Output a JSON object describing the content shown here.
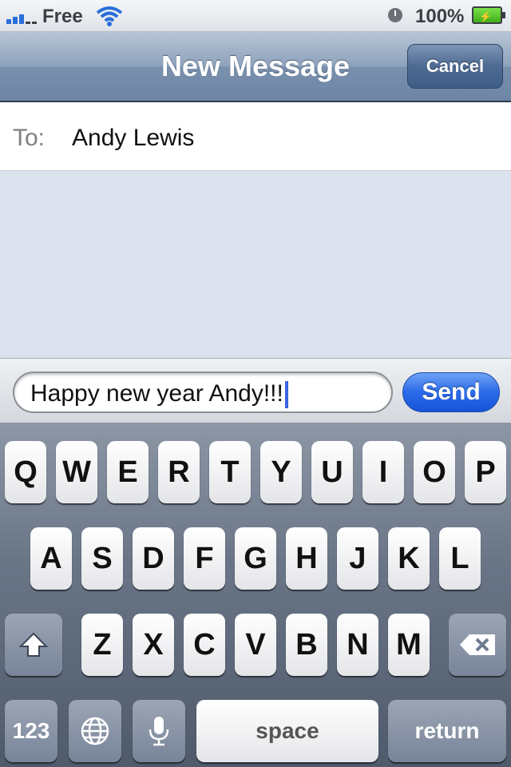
{
  "status_bar": {
    "carrier": "Free",
    "battery": "100%"
  },
  "nav": {
    "title": "New Message",
    "cancel_label": "Cancel"
  },
  "recipient": {
    "label": "To:",
    "value": "Andy Lewis"
  },
  "compose": {
    "text": "Happy new year Andy!!!",
    "send_label": "Send"
  },
  "keyboard": {
    "row1": [
      "Q",
      "W",
      "E",
      "R",
      "T",
      "Y",
      "U",
      "I",
      "O",
      "P"
    ],
    "row2": [
      "A",
      "S",
      "D",
      "F",
      "G",
      "H",
      "J",
      "K",
      "L"
    ],
    "row3": [
      "Z",
      "X",
      "C",
      "V",
      "B",
      "N",
      "M"
    ],
    "numbers_label": "123",
    "space_label": "space",
    "return_label": "return"
  },
  "icons": {
    "signal": "signal-bars-icon",
    "wifi": "wifi-icon",
    "alarm": "alarm-clock-icon",
    "battery": "battery-charging-icon",
    "shift": "shift-icon",
    "backspace": "backspace-icon",
    "globe": "globe-icon",
    "microphone": "microphone-icon"
  },
  "colors": {
    "send_blue": "#2b6ae8",
    "nav_blue": "#7990ad",
    "battery_green": "#3fae1a"
  }
}
